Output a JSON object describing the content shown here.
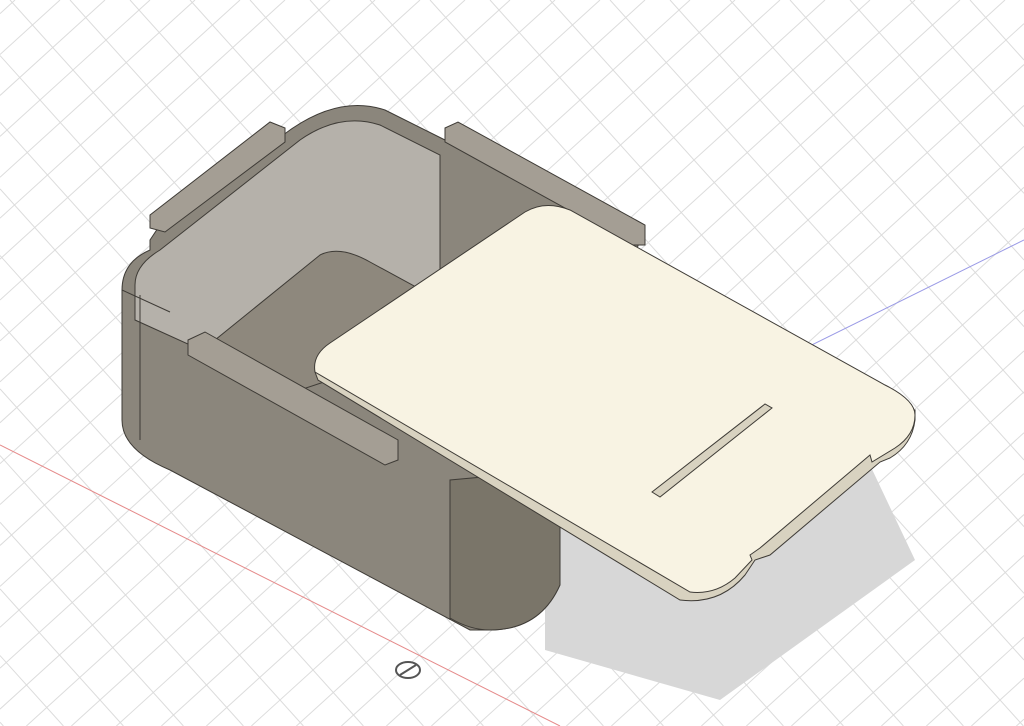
{
  "viewport": {
    "colors": {
      "background": "#ffffff",
      "grid": "#dcdcdc",
      "x_axis": "#e58a8a",
      "y_axis": "#9a9ae6",
      "box_outer": "#8b867c",
      "box_outer_dark": "#7a7569",
      "box_inner_wall": "#b5b1aa",
      "box_floor": "#8e887d",
      "rail": "#a49e94",
      "lid": "#f8f3e3",
      "lid_edge": "#d8d2c0",
      "shadow": "#d7d7d7",
      "edge": "#3e3b36"
    }
  }
}
